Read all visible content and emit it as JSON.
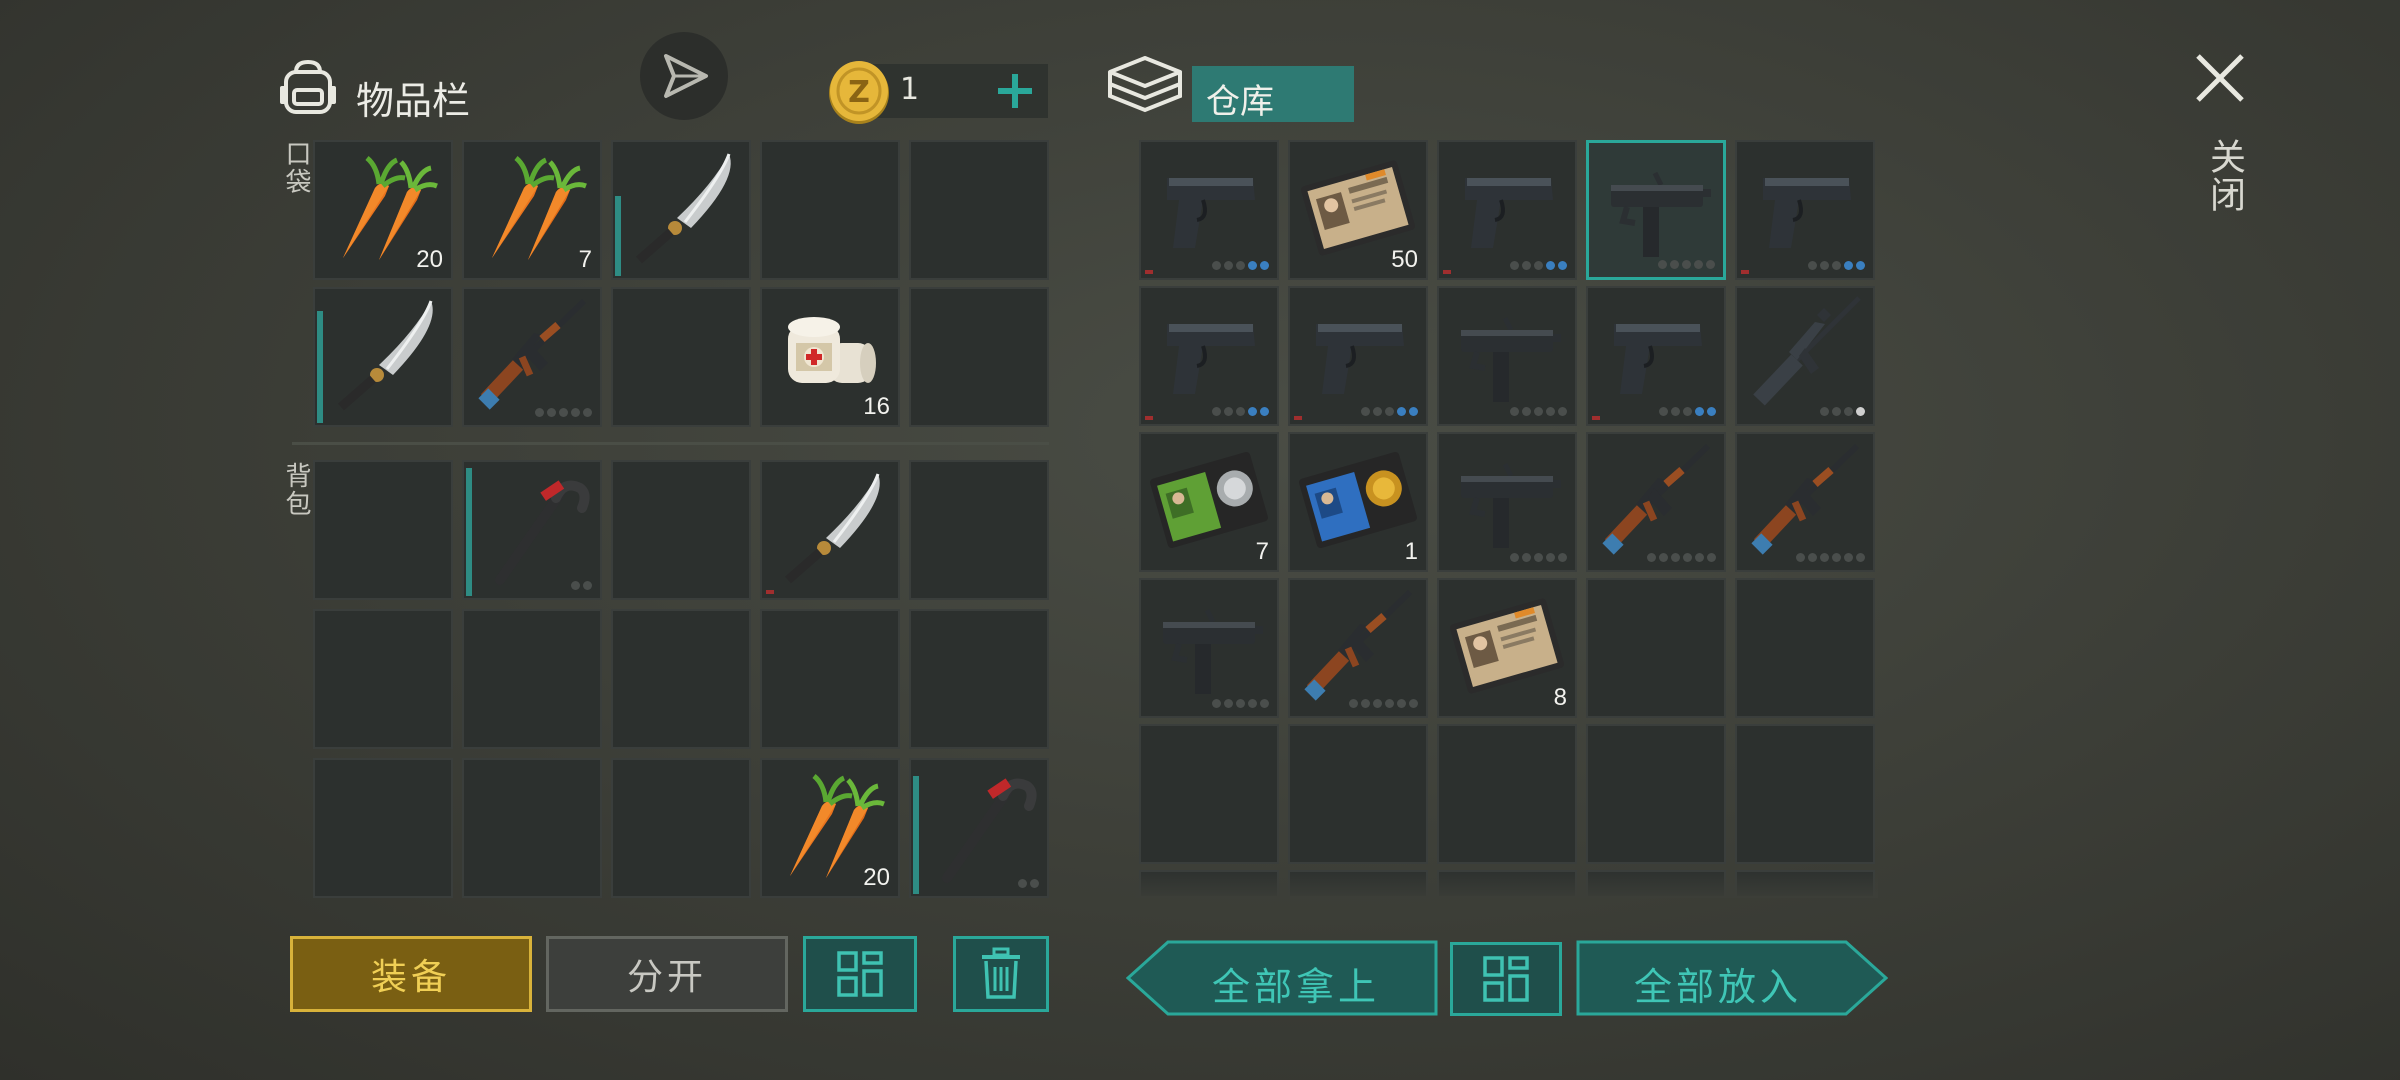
{
  "header": {
    "inventory_title": "物品栏",
    "coins": "1",
    "storage_title": "仓库",
    "close_label": "关闭"
  },
  "sections": {
    "pockets_label": "口袋",
    "backpack_label": "背包"
  },
  "inventory": {
    "pockets": [
      {
        "item": "carrot",
        "qty": "20"
      },
      {
        "item": "carrot",
        "qty": "7"
      },
      {
        "item": "machete",
        "qty": ""
      },
      {
        "item": "",
        "qty": ""
      },
      {
        "item": "",
        "qty": ""
      },
      {
        "item": "machete",
        "qty": ""
      },
      {
        "item": "ak-rifle",
        "qty": ""
      },
      {
        "item": "",
        "qty": ""
      },
      {
        "item": "bandage",
        "qty": "16"
      },
      {
        "item": "",
        "qty": ""
      }
    ],
    "backpack": [
      {
        "item": "",
        "qty": ""
      },
      {
        "item": "crowbar",
        "qty": ""
      },
      {
        "item": "",
        "qty": ""
      },
      {
        "item": "machete",
        "qty": ""
      },
      {
        "item": "",
        "qty": ""
      },
      {
        "item": "",
        "qty": ""
      },
      {
        "item": "",
        "qty": ""
      },
      {
        "item": "",
        "qty": ""
      },
      {
        "item": "",
        "qty": ""
      },
      {
        "item": "",
        "qty": ""
      },
      {
        "item": "",
        "qty": ""
      },
      {
        "item": "",
        "qty": ""
      },
      {
        "item": "",
        "qty": ""
      },
      {
        "item": "carrot",
        "qty": "20"
      },
      {
        "item": "crowbar",
        "qty": ""
      }
    ]
  },
  "storage": [
    {
      "item": "pistol",
      "qty": ""
    },
    {
      "item": "police-badge-wallet",
      "qty": "50"
    },
    {
      "item": "pistol",
      "qty": ""
    },
    {
      "item": "uzi",
      "qty": ""
    },
    {
      "item": "pistol",
      "qty": ""
    },
    {
      "item": "pistol",
      "qty": ""
    },
    {
      "item": "pistol",
      "qty": ""
    },
    {
      "item": "uzi",
      "qty": ""
    },
    {
      "item": "pistol",
      "qty": ""
    },
    {
      "item": "m16-rifle",
      "qty": ""
    },
    {
      "item": "green-id-card",
      "qty": "7"
    },
    {
      "item": "blue-id-card",
      "qty": "1"
    },
    {
      "item": "uzi",
      "qty": ""
    },
    {
      "item": "ak-rifle",
      "qty": ""
    },
    {
      "item": "ak-rifle",
      "qty": ""
    },
    {
      "item": "uzi",
      "qty": ""
    },
    {
      "item": "ak-rifle",
      "qty": ""
    },
    {
      "item": "police-badge-wallet",
      "qty": "8"
    },
    {
      "item": "",
      "qty": ""
    },
    {
      "item": "",
      "qty": ""
    },
    {
      "item": "",
      "qty": ""
    },
    {
      "item": "",
      "qty": ""
    },
    {
      "item": "",
      "qty": ""
    },
    {
      "item": "",
      "qty": ""
    },
    {
      "item": "",
      "qty": ""
    }
  ],
  "buttons": {
    "equip": "装备",
    "split": "分开",
    "take_all": "全部拿上",
    "put_all": "全部放入"
  },
  "colors": {
    "accent_teal": "#2aa89a",
    "equip_gold": "#d8b23a",
    "ammo_blue": "#3a7fc0"
  }
}
